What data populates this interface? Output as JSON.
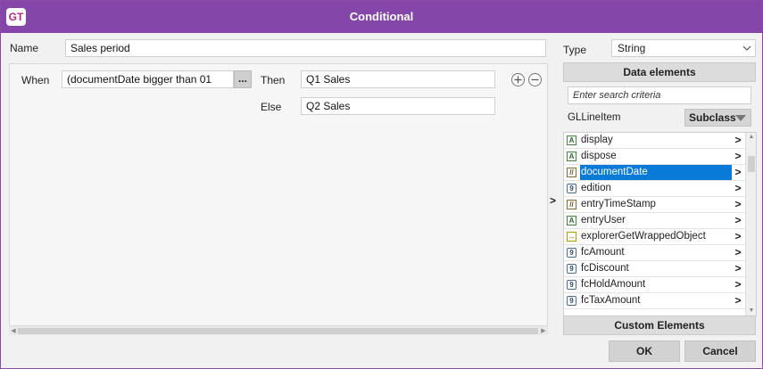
{
  "window": {
    "logo": "GT",
    "title": "Conditional"
  },
  "form": {
    "name_label": "Name",
    "name_value": "Sales period",
    "when_label": "When",
    "when_value": "(documentDate bigger than 01",
    "ellipsis": "...",
    "then_label": "Then",
    "then_value": "Q1 Sales",
    "else_label": "Else",
    "else_value": "Q2 Sales"
  },
  "right": {
    "type_label": "Type",
    "type_value": "String",
    "data_elements_header": "Data elements",
    "search_placeholder": "Enter search criteria",
    "class_name": "GLLineItem",
    "subclass_label": "Subclass",
    "transfer_arrow": ">",
    "custom_elements_header": "Custom Elements"
  },
  "elements": [
    {
      "icon": "A",
      "kind": "A",
      "label": "display",
      "arrow": ">"
    },
    {
      "icon": "A",
      "kind": "A",
      "label": "dispose",
      "arrow": ">"
    },
    {
      "icon": "//",
      "kind": "D",
      "label": "documentDate",
      "arrow": ">",
      "selected": true
    },
    {
      "icon": "9",
      "kind": "N",
      "label": "edition",
      "arrow": ">"
    },
    {
      "icon": "//",
      "kind": "D",
      "label": "entryTimeStamp",
      "arrow": ">"
    },
    {
      "icon": "A",
      "kind": "A",
      "label": "entryUser",
      "arrow": ">"
    },
    {
      "icon": "→",
      "kind": "M",
      "label": "explorerGetWrappedObject",
      "arrow": ">"
    },
    {
      "icon": "9",
      "kind": "N",
      "label": "fcAmount",
      "arrow": ">"
    },
    {
      "icon": "9",
      "kind": "N",
      "label": "fcDiscount",
      "arrow": ">"
    },
    {
      "icon": "9",
      "kind": "N",
      "label": "fcHoldAmount",
      "arrow": ">"
    },
    {
      "icon": "9",
      "kind": "N",
      "label": "fcTaxAmount",
      "arrow": ">"
    }
  ],
  "buttons": {
    "ok": "OK",
    "cancel": "Cancel"
  },
  "colors": {
    "titlebar": "#8447a9",
    "selection": "#0a7ad8"
  }
}
